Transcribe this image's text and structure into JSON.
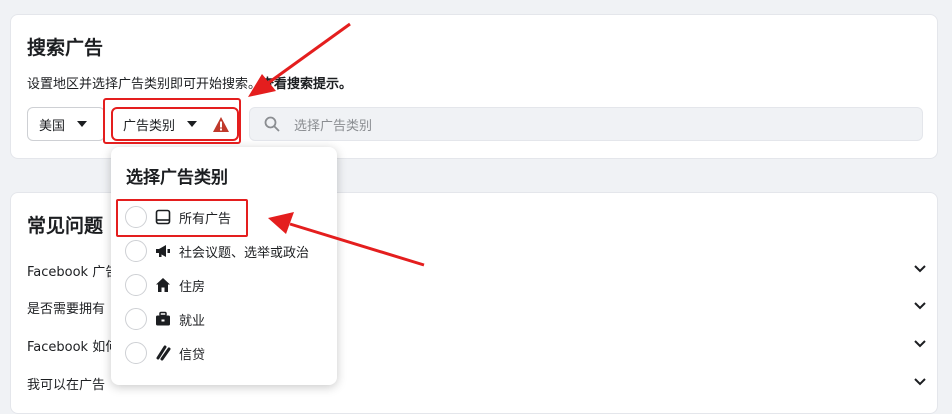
{
  "search": {
    "title": "搜索广告",
    "hint_prefix": "设置地区并选择广告类别即可开始搜索。",
    "hint_link": "查看搜索提示。",
    "country_label": "美国",
    "category_label": "广告类别",
    "placeholder": "选择广告类别"
  },
  "dropdown": {
    "title": "选择广告类别",
    "options": [
      {
        "label": "所有广告",
        "icon": "tablet-icon"
      },
      {
        "label": "社会议题、选举或政治",
        "icon": "megaphone-icon"
      },
      {
        "label": "住房",
        "icon": "house-icon"
      },
      {
        "label": "就业",
        "icon": "briefcase-icon"
      },
      {
        "label": "信贷",
        "icon": "credit-icon"
      }
    ]
  },
  "faq": {
    "title": "常见问题",
    "items": [
      "Facebook 广告",
      "是否需要拥有",
      "Facebook 如何",
      "我可以在广告"
    ]
  },
  "colors": {
    "highlight": "#e41e1e",
    "warning": "#c0392b"
  }
}
